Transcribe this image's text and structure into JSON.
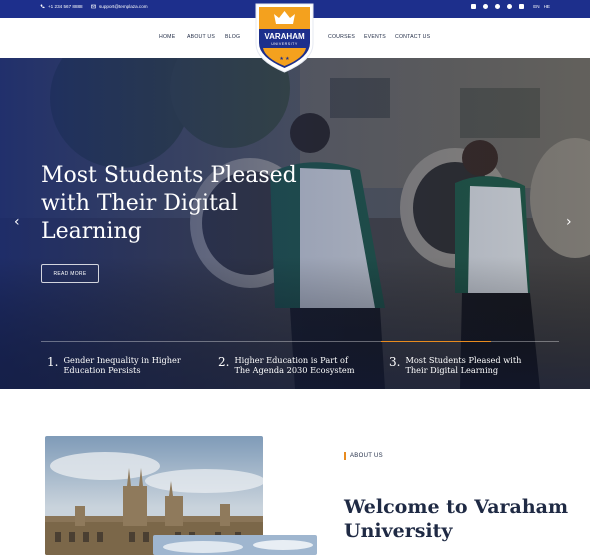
{
  "topbar": {
    "phone": "+1 234 567 8888",
    "email": "support@templaza.com",
    "social_icons": [
      "facebook-icon",
      "twitter-icon",
      "github-icon",
      "dribbble-icon",
      "youtube-icon"
    ],
    "languages": [
      "EN",
      "HE"
    ]
  },
  "nav": {
    "left_items": [
      "HOME",
      "ABOUT US",
      "BLOG"
    ],
    "right_items": [
      "COURSES",
      "EVENTS",
      "CONTACT US"
    ]
  },
  "logo": {
    "name": "VARAHAM",
    "sub": "UNIVERSITY",
    "colors": {
      "shield": "#1d2f8c",
      "accent": "#f4a11e"
    }
  },
  "hero": {
    "title": "Most Students Pleased with Their Digital Learning",
    "button": "READ MORE",
    "prev_arrow": "‹",
    "next_arrow": "›",
    "slides": [
      {
        "num": "1.",
        "text": "Gender Inequality in Higher Education Persists"
      },
      {
        "num": "2.",
        "text": "Higher Education is Part of The Agenda 2030 Ecosystem"
      },
      {
        "num": "3.",
        "text": "Most Students Pleased with Their Digital Learning"
      }
    ],
    "active_slide": 3,
    "accent_color": "#e88b1f"
  },
  "about": {
    "label": "ABOUT US",
    "title": "Welcome to Varaham University"
  }
}
